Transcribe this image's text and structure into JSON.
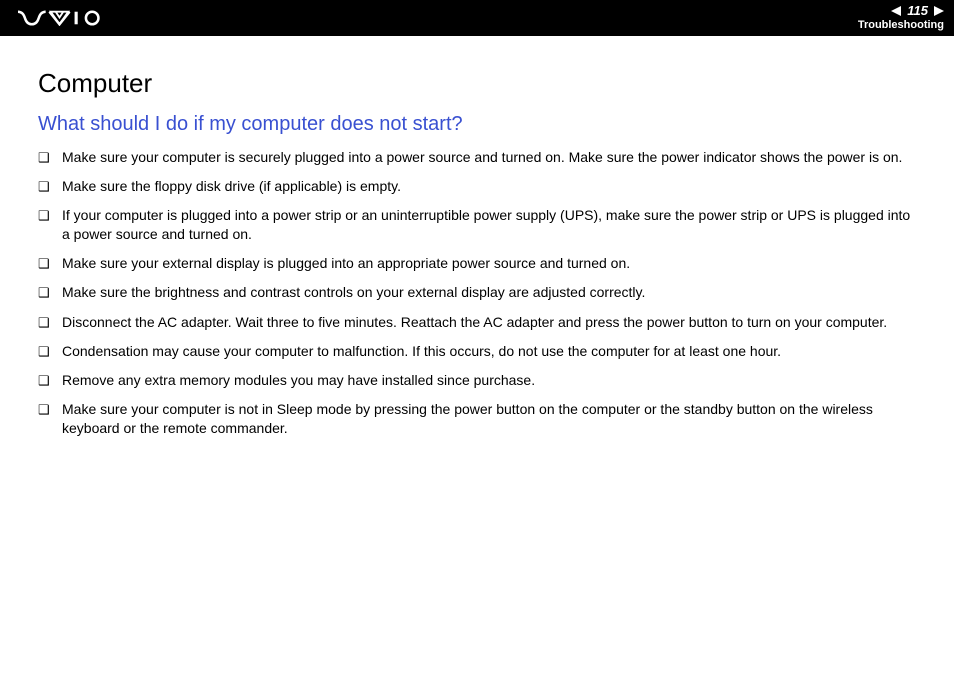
{
  "header": {
    "logo_name": "vaio-logo",
    "page_number": "115",
    "section": "Troubleshooting"
  },
  "content": {
    "heading": "Computer",
    "subheading": "What should I do if my computer does not start?",
    "bullets": [
      "Make sure your computer is securely plugged into a power source and turned on. Make sure the power indicator shows the power is on.",
      "Make sure the floppy disk drive (if applicable) is empty.",
      "If your computer is plugged into a power strip or an uninterruptible power supply (UPS), make sure the power strip or UPS is plugged into a power source and turned on.",
      "Make sure your external display is plugged into an appropriate power source and turned on.",
      "Make sure the brightness and contrast controls on your external display are adjusted correctly.",
      "Disconnect the AC adapter. Wait three to five minutes. Reattach the AC adapter and press the power button to turn on your computer.",
      "Condensation may cause your computer to malfunction. If this occurs, do not use the computer for at least one hour.",
      "Remove any extra memory modules you may have installed since purchase.",
      "Make sure your computer is not in Sleep mode by pressing the power button on the computer or the standby button on the wireless keyboard or the remote commander."
    ]
  }
}
